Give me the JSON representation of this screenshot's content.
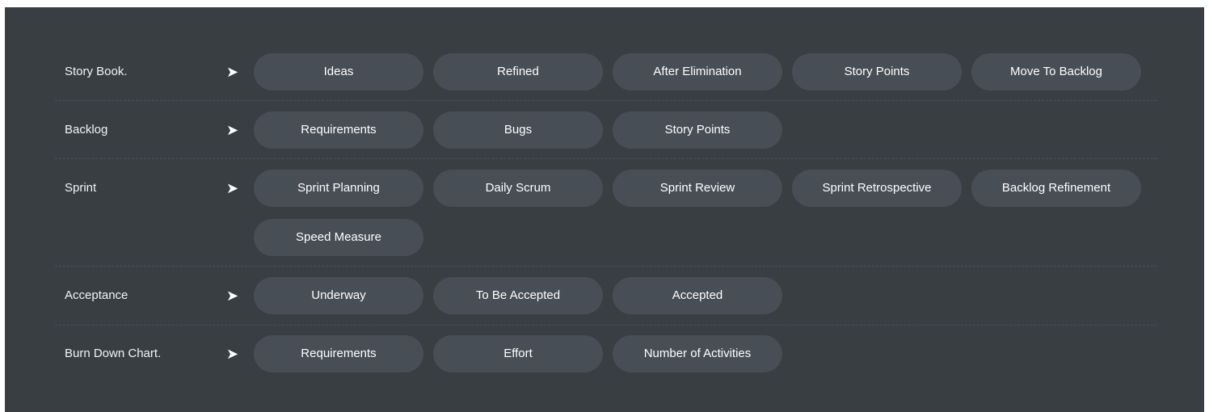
{
  "rows": [
    {
      "label": "Story Book.",
      "arrow": "➤",
      "items": [
        "Ideas",
        "Refined",
        "After Elimination",
        "Story Points",
        "Move To Backlog"
      ]
    },
    {
      "label": "Backlog",
      "arrow": "➤",
      "items": [
        "Requirements",
        "Bugs",
        "Story Points"
      ]
    },
    {
      "label": "Sprint",
      "arrow": "➤",
      "items": [
        "Sprint Planning",
        "Daily Scrum",
        "Sprint Review",
        "Sprint Retrospective",
        "Backlog Refinement",
        "Speed Measure"
      ]
    },
    {
      "label": "Acceptance",
      "arrow": "➤",
      "items": [
        "Underway",
        "To Be Accepted",
        "Accepted"
      ]
    },
    {
      "label": "Burn Down Chart.",
      "arrow": "➤",
      "items": [
        "Requirements",
        "Effort",
        "Number of Activities"
      ]
    }
  ]
}
